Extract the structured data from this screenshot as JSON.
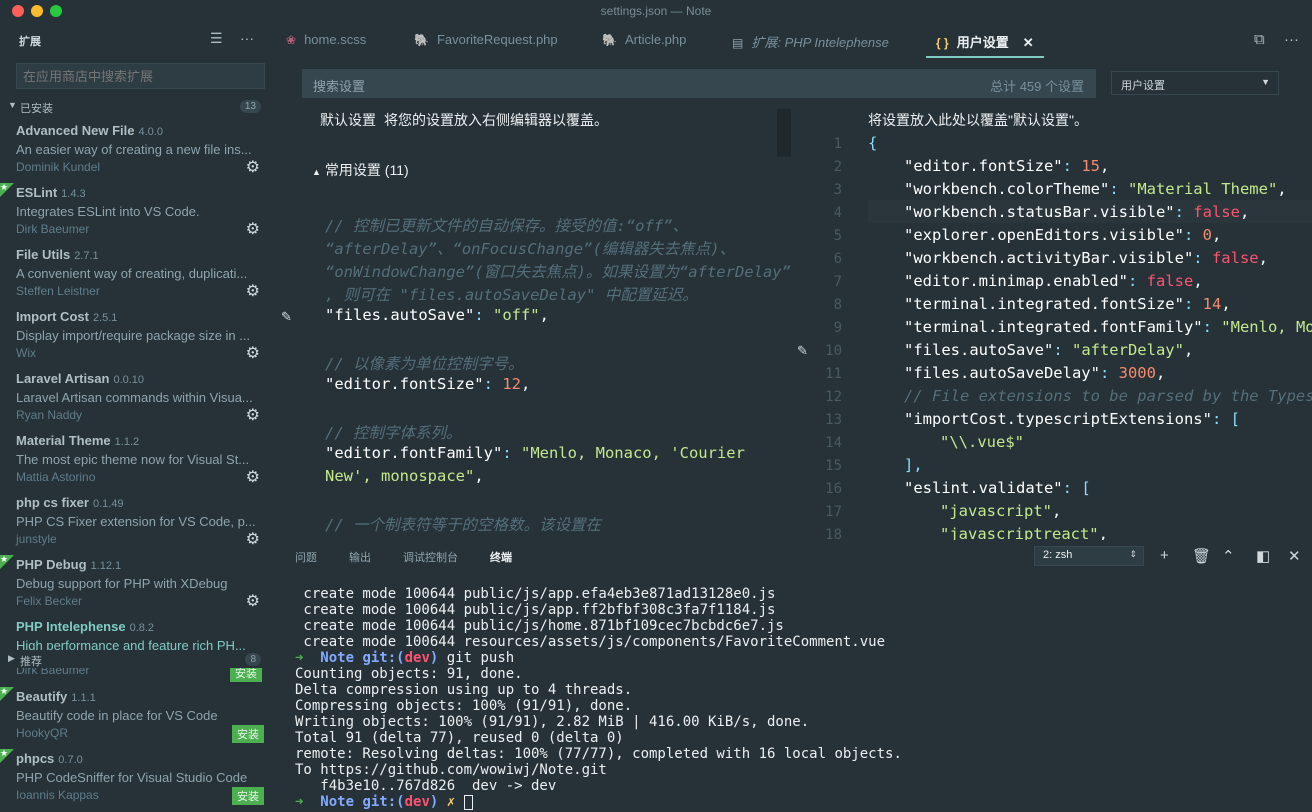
{
  "window": {
    "title": "settings.json — Note"
  },
  "sidebar": {
    "title": "扩展",
    "search_placeholder": "在应用商店中搜索扩展",
    "installed": {
      "label": "已安装",
      "count": "13",
      "items": [
        {
          "name": "Advanced New File",
          "version": "4.0.0",
          "desc": "An easier way of creating a new file ins...",
          "author": "Dominik Kundel",
          "starred": false
        },
        {
          "name": "ESLint",
          "version": "1.4.3",
          "desc": "Integrates ESLint into VS Code.",
          "author": "Dirk Baeumer",
          "starred": true
        },
        {
          "name": "File Utils",
          "version": "2.7.1",
          "desc": "A convenient way of creating, duplicati...",
          "author": "Steffen Leistner",
          "starred": false
        },
        {
          "name": "Import Cost",
          "version": "2.5.1",
          "desc": "Display import/require package size in ...",
          "author": "Wix",
          "starred": false
        },
        {
          "name": "Laravel Artisan",
          "version": "0.0.10",
          "desc": "Laravel Artisan commands within Visua...",
          "author": "Ryan Naddy",
          "starred": false
        },
        {
          "name": "Material Theme",
          "version": "1.1.2",
          "desc": "The most epic theme now for Visual St...",
          "author": "Mattia Astorino",
          "starred": false
        },
        {
          "name": "php cs fixer",
          "version": "0.1.49",
          "desc": "PHP CS Fixer extension for VS Code, p...",
          "author": "junstyle",
          "starred": false
        },
        {
          "name": "PHP Debug",
          "version": "1.12.1",
          "desc": "Debug support for PHP with XDebug",
          "author": "Felix Becker",
          "starred": true
        },
        {
          "name": "PHP Intelephense",
          "version": "0.8.2",
          "desc": "High performance and feature rich PH...",
          "author": "",
          "starred": false
        }
      ]
    },
    "recommended": {
      "label": "推荐",
      "count": "8",
      "peek_author": "Dirk Baeumer",
      "peek_install": "安装",
      "items": [
        {
          "name": "Beautify",
          "version": "1.1.1",
          "desc": "Beautify code in place for VS Code",
          "author": "HookyQR",
          "action": "安装",
          "starred": true
        },
        {
          "name": "phpcs",
          "version": "0.7.0",
          "desc": "PHP CodeSniffer for Visual Studio Code",
          "author": "Ioannis Kappas",
          "action": "安装",
          "starred": true
        }
      ]
    }
  },
  "tabs": [
    {
      "label": "home.scss",
      "icon": "sass-icon"
    },
    {
      "label": "FavoriteRequest.php",
      "icon": "php-icon"
    },
    {
      "label": "Article.php",
      "icon": "php-icon"
    },
    {
      "label": "扩展: PHP Intelephense",
      "icon": "file-icon"
    },
    {
      "label": "用户设置",
      "icon": "json-icon",
      "active": true
    }
  ],
  "settings": {
    "search_placeholder": "搜索设置",
    "total": "总计 459 个设置",
    "scope_select": "用户设置",
    "left_title_a": "默认设置",
    "left_title_b": "将您的设置放入右侧编辑器以覆盖。",
    "group": "常用设置 (11)",
    "right_title": "将设置放入此处以覆盖\"默认设置\"。"
  },
  "default_settings": [
    {
      "t": "cmt",
      "text": "// 控制已更新文件的自动保存。接受的值:“off”、"
    },
    {
      "t": "cmt",
      "text": "“afterDelay”、“onFocusChange”(编辑器失去焦点)、"
    },
    {
      "t": "cmt",
      "text": "“onWindowChange”(窗口失去焦点)。如果设置为“afterDelay”"
    },
    {
      "t": "cmt",
      "text": ", 则可在 \"files.autoSaveDelay\" 中配置延迟。"
    },
    {
      "t": "kv",
      "key": "\"files.autoSave\"",
      "val": "\"off\"",
      "vt": "str"
    },
    {
      "t": "blank"
    },
    {
      "t": "cmt",
      "text": "// 以像素为单位控制字号。"
    },
    {
      "t": "kv",
      "key": "\"editor.fontSize\"",
      "val": "12",
      "vt": "num"
    },
    {
      "t": "blank"
    },
    {
      "t": "cmt",
      "text": "// 控制字体系列。"
    },
    {
      "t": "kv",
      "key": "\"editor.fontFamily\"",
      "val": "\"Menlo, Monaco, 'Courier",
      "vt": "str",
      "nocomma": true
    },
    {
      "t": "cont",
      "text": "New', monospace\""
    },
    {
      "t": "blank"
    },
    {
      "t": "cmt",
      "text": "// 一个制表符等于的空格数。该设置在"
    }
  ],
  "user_settings": [
    {
      "n": "1",
      "t": "plain",
      "text": "{"
    },
    {
      "n": "2",
      "t": "kv",
      "key": "\"editor.fontSize\"",
      "val": "15",
      "vt": "num",
      "indent": 1
    },
    {
      "n": "3",
      "t": "kv",
      "key": "\"workbench.colorTheme\"",
      "val": "\"Material Theme\"",
      "vt": "str",
      "indent": 1
    },
    {
      "n": "4",
      "t": "kv",
      "key": "\"workbench.statusBar.visible\"",
      "val": "false",
      "vt": "bool",
      "indent": 1
    },
    {
      "n": "5",
      "t": "kv",
      "key": "\"explorer.openEditors.visible\"",
      "val": "0",
      "vt": "num",
      "indent": 1
    },
    {
      "n": "6",
      "t": "kv",
      "key": "\"workbench.activityBar.visible\"",
      "val": "false",
      "vt": "bool",
      "indent": 1
    },
    {
      "n": "7",
      "t": "kv",
      "key": "\"editor.minimap.enabled\"",
      "val": "false",
      "vt": "bool",
      "indent": 1
    },
    {
      "n": "8",
      "t": "kv",
      "key": "\"terminal.integrated.fontSize\"",
      "val": "14",
      "vt": "num",
      "indent": 1
    },
    {
      "n": "9",
      "t": "kv",
      "key": "\"terminal.integrated.fontFamily\"",
      "val": "\"Menlo, Monaco",
      "vt": "str",
      "indent": 1
    },
    {
      "n": "10",
      "t": "kv",
      "key": "\"files.autoSave\"",
      "val": "\"afterDelay\"",
      "vt": "str",
      "indent": 1
    },
    {
      "n": "11",
      "t": "kv",
      "key": "\"files.autoSaveDelay\"",
      "val": "3000",
      "vt": "num",
      "indent": 1
    },
    {
      "n": "12",
      "t": "cmt",
      "text": "// File extensions to be parsed by the Typescript",
      "indent": 1
    },
    {
      "n": "13",
      "t": "kvopen",
      "key": "\"importCost.typescriptExtensions\"",
      "open": "[",
      "indent": 1
    },
    {
      "n": "14",
      "t": "strline",
      "text": "\"\\\\.vue$\"",
      "indent": 2,
      "nocomma": true
    },
    {
      "n": "15",
      "t": "plain",
      "text": "],",
      "indent": 1
    },
    {
      "n": "16",
      "t": "kvopen",
      "key": "\"eslint.validate\"",
      "open": "[",
      "indent": 1
    },
    {
      "n": "17",
      "t": "strline",
      "text": "\"javascript\"",
      "indent": 2
    },
    {
      "n": "18",
      "t": "strline",
      "text": "\"javascriptreact\"",
      "indent": 2
    }
  ],
  "panel": {
    "tabs": [
      "问题",
      "输出",
      "调试控制台",
      "终端"
    ],
    "active_tab": "终端",
    "terminal_select": "2: zsh",
    "lines": [
      {
        "t": "out",
        "text": " create mode 100644 public/js/app.efa4eb3e871ad13128e0.js"
      },
      {
        "t": "out",
        "text": " create mode 100644 public/js/app.ff2bfbf308c3fa7f1184.js"
      },
      {
        "t": "out",
        "text": " create mode 100644 public/js/home.871bf109cec7bcbdc6e7.js"
      },
      {
        "t": "out",
        "text": " create mode 100644 resources/assets/js/components/FavoriteComment.vue"
      },
      {
        "t": "prompt",
        "dir": "Note",
        "branch": "dev",
        "cmd": "git push",
        "dirty": false
      },
      {
        "t": "out",
        "text": "Counting objects: 91, done."
      },
      {
        "t": "out",
        "text": "Delta compression using up to 4 threads."
      },
      {
        "t": "out",
        "text": "Compressing objects: 100% (91/91), done."
      },
      {
        "t": "out",
        "text": "Writing objects: 100% (91/91), 2.82 MiB | 416.00 KiB/s, done."
      },
      {
        "t": "out",
        "text": "Total 91 (delta 77), reused 0 (delta 0)"
      },
      {
        "t": "out",
        "text": "remote: Resolving deltas: 100% (77/77), completed with 16 local objects."
      },
      {
        "t": "out",
        "text": "To https://github.com/wowiwj/Note.git"
      },
      {
        "t": "out",
        "text": "   f4b3e10..767d826  dev -> dev"
      },
      {
        "t": "prompt",
        "dir": "Note",
        "branch": "dev",
        "cmd": "",
        "dirty": true
      }
    ]
  }
}
